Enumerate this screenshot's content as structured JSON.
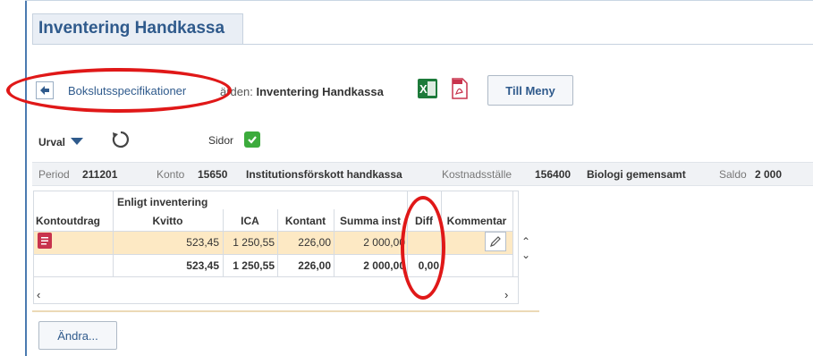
{
  "page": {
    "title": "Inventering Handkassa"
  },
  "toolbar": {
    "back_label": "Bokslutsspecifikationer",
    "crumb_prefix": "ärden:",
    "crumb_current": "Inventering Handkassa",
    "menu_button": "Till Meny",
    "excel_icon": "excel-icon",
    "pdf_icon": "pdf-icon"
  },
  "filters": {
    "urval_label": "Urval",
    "sidor_label": "Sidor",
    "sidor_checked": true
  },
  "info": {
    "period_label": "Period",
    "period_value": "211201",
    "konto_label": "Konto",
    "konto_value": "15650",
    "konto_name": "Institutionsförskott handkassa",
    "kst_label": "Kostnadsställe",
    "kst_value": "156400",
    "kst_name": "Biologi gemensamt",
    "saldo_label": "Saldo",
    "saldo_value": "2 000"
  },
  "grid": {
    "group_header": "Enligt inventering",
    "columns": [
      "Kontoutdrag",
      "Kvitto",
      "ICA",
      "Kontant",
      "Summa inst",
      "Diff",
      "Kommentar"
    ],
    "rows": [
      {
        "kvitto": "523,45",
        "ica": "1 250,55",
        "kontant": "226,00",
        "summa": "2 000,00",
        "diff": ""
      }
    ],
    "totals": {
      "kvitto": "523,45",
      "ica": "1 250,55",
      "kontant": "226,00",
      "summa": "2 000,00",
      "diff": "0,00"
    }
  },
  "actions": {
    "edit_button": "Ändra..."
  },
  "colors": {
    "accent": "#2f5a8c",
    "selected_row": "#fde9c4",
    "annotation": "#e01818"
  }
}
